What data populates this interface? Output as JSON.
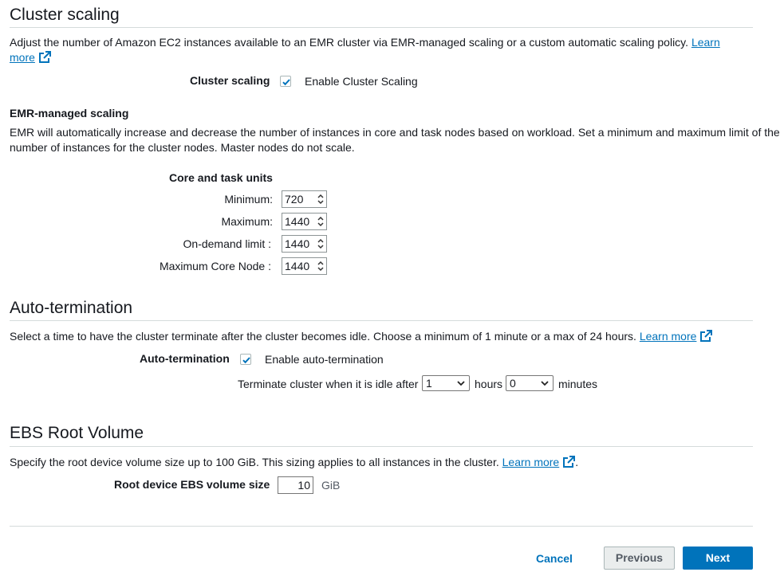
{
  "cluster_scaling": {
    "title": "Cluster scaling",
    "description": "Adjust the number of Amazon EC2 instances available to an EMR cluster via EMR-managed scaling or a custom automatic scaling policy.",
    "learn_more_part1": "Learn",
    "learn_more_part2": "more",
    "field_label": "Cluster scaling",
    "checkbox_label": "Enable Cluster Scaling",
    "checked": true
  },
  "emr_managed": {
    "title": "EMR-managed scaling",
    "description_line1": "EMR will automatically increase and decrease the number of instances in core and task nodes based on workload. Set a minimum and maximum limit of the",
    "description_line2": "number of instances for the cluster nodes. Master nodes do not scale.",
    "units_heading": "Core and task units",
    "fields": [
      {
        "label": "Minimum:",
        "value": "720"
      },
      {
        "label": "Maximum:",
        "value": "1440"
      },
      {
        "label": "On-demand limit :",
        "value": "1440"
      },
      {
        "label": "Maximum Core Node :",
        "value": "1440"
      }
    ]
  },
  "auto_termination": {
    "title": "Auto-termination",
    "description": "Select a time to have the cluster terminate after the cluster becomes idle. Choose a minimum of 1 minute or a max of 24 hours.",
    "learn_more": "Learn more",
    "field_label": "Auto-termination",
    "checkbox_label": "Enable auto-termination",
    "checked": true,
    "idle_prefix": "Terminate cluster when it is idle after",
    "hours_value": "1",
    "hours_label": "hours",
    "minutes_value": "0",
    "minutes_label": "minutes"
  },
  "ebs": {
    "title": "EBS Root Volume",
    "description": "Specify the root device volume size up to 100 GiB. This sizing applies to all instances in the cluster.",
    "learn_more": "Learn more",
    "trailing": ".",
    "field_label": "Root device EBS volume size",
    "value": "10",
    "unit": "GiB"
  },
  "footer": {
    "cancel": "Cancel",
    "previous": "Previous",
    "next": "Next"
  },
  "colors": {
    "link": "#0073bb",
    "primary": "#0073bb",
    "secondary_bg": "#eaeded"
  }
}
